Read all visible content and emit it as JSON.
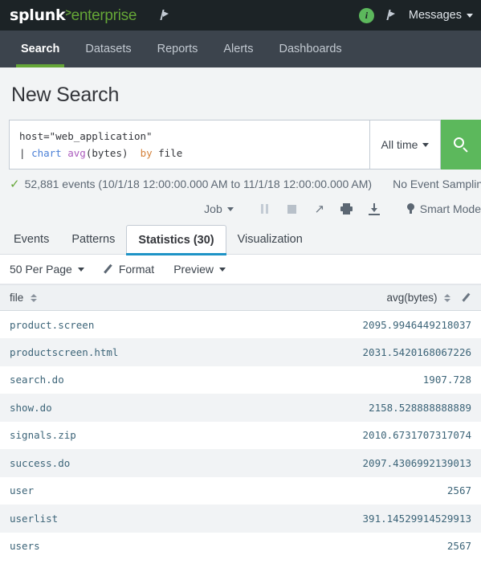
{
  "topbar": {
    "logo_main": "splunk",
    "logo_sep": ">",
    "logo_sub": "enterprise",
    "app_menu_icon": "flag-dropdown-icon",
    "info_icon_label": "i",
    "activity_icon": "flag-dropdown-icon",
    "messages_label": "Messages"
  },
  "nav": {
    "items": [
      {
        "label": "Search",
        "active": true
      },
      {
        "label": "Datasets",
        "active": false
      },
      {
        "label": "Reports",
        "active": false
      },
      {
        "label": "Alerts",
        "active": false
      },
      {
        "label": "Dashboards",
        "active": false
      }
    ]
  },
  "page": {
    "title": "New Search"
  },
  "search": {
    "query_line1": "host=\"web_application\"",
    "query_pipe": "|",
    "query_cmd": "chart",
    "query_fn": "avg",
    "query_fn_arg": "(bytes)",
    "query_by": "by",
    "query_field": "file",
    "time_range_label": "All time",
    "search_button_icon": "magnifier-icon"
  },
  "status": {
    "check_glyph": "✓",
    "events_text": "52,881 events (10/1/18 12:00:00.000 AM to 11/1/18 12:00:00.000 AM)",
    "sampling_label": "No Event Sampling"
  },
  "jobbar": {
    "job_label": "Job",
    "pause_icon": "pause-icon",
    "stop_icon": "stop-icon",
    "share_icon": "share-icon",
    "share_glyph": "↗",
    "print_icon": "print-icon",
    "export_icon": "export-icon",
    "mode_label": "Smart Mode",
    "mode_icon": "lightbulb-icon"
  },
  "result_tabs": [
    {
      "label": "Events",
      "active": false
    },
    {
      "label": "Patterns",
      "active": false
    },
    {
      "label": "Statistics (30)",
      "active": true
    },
    {
      "label": "Visualization",
      "active": false
    }
  ],
  "format_toolbar": {
    "per_page_label": "50 Per Page",
    "format_label": "Format",
    "format_icon": "pencil-icon",
    "preview_label": "Preview"
  },
  "table": {
    "columns": [
      {
        "label": "file",
        "align": "left",
        "sortable": true
      },
      {
        "label": "avg(bytes)",
        "align": "right",
        "sortable": true,
        "editable": true
      }
    ],
    "rows": [
      {
        "file": "product.screen",
        "avg_bytes": "2095.9946449218037"
      },
      {
        "file": "productscreen.html",
        "avg_bytes": "2031.5420168067226"
      },
      {
        "file": "search.do",
        "avg_bytes": "1907.728"
      },
      {
        "file": "show.do",
        "avg_bytes": "2158.528888888889"
      },
      {
        "file": "signals.zip",
        "avg_bytes": "2010.6731707317074"
      },
      {
        "file": "success.do",
        "avg_bytes": "2097.4306992139013"
      },
      {
        "file": "user",
        "avg_bytes": "2567"
      },
      {
        "file": "userlist",
        "avg_bytes": "391.14529914529913"
      },
      {
        "file": "users",
        "avg_bytes": "2567"
      }
    ]
  },
  "colors": {
    "topbar_bg": "#1c2326",
    "navbar_bg": "#3c444d",
    "accent_green": "#65a637",
    "search_green": "#5cb85c",
    "active_tab_blue": "#1e93c6",
    "page_bg": "#f2f4f5",
    "cell_text": "#3c6478"
  }
}
